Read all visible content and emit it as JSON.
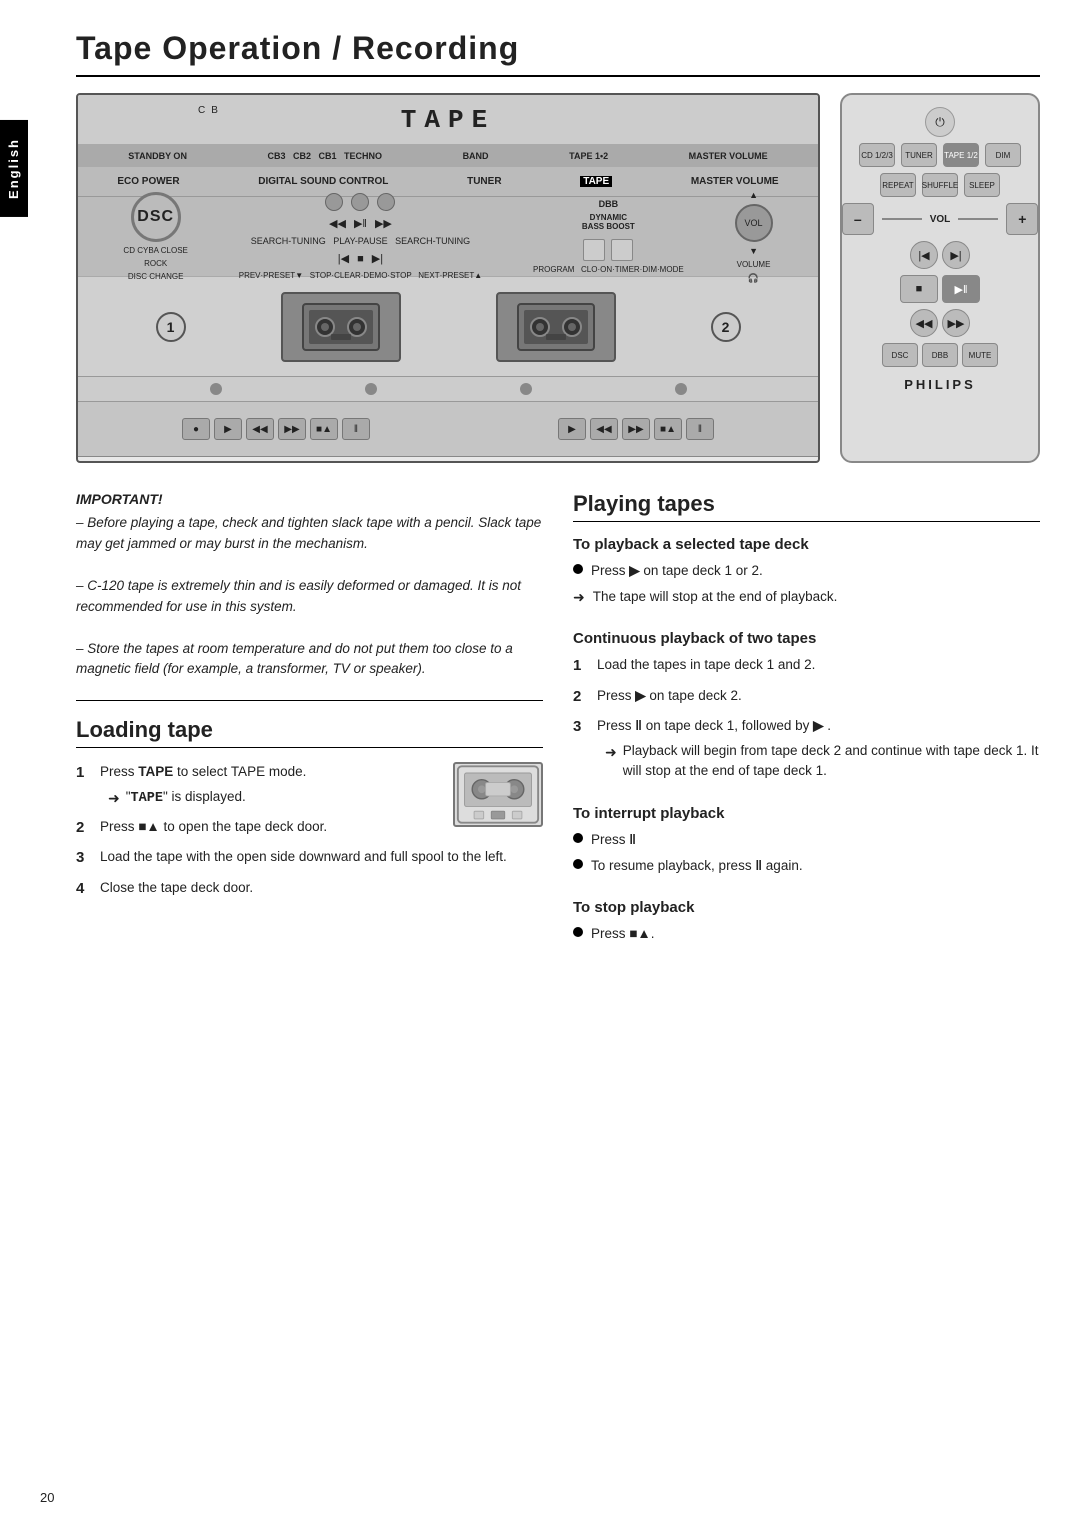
{
  "page": {
    "title": "Tape Operation / Recording",
    "page_number": "20",
    "language_tab": "English"
  },
  "device": {
    "display_text": "TAPE",
    "deck1_label": "1",
    "deck2_label": "2"
  },
  "remote": {
    "philips_label": "PHILIPS"
  },
  "important": {
    "title": "IMPORTANT!",
    "lines": [
      "– Before playing a tape, check and tighten slack tape with a pencil. Slack tape may get jammed or may burst in the mechanism.",
      "– C-120 tape is extremely thin and is easily deformed or damaged. It is not recommended for use in this system.",
      "– Store the tapes at room temperature and do not put them too close to a magnetic field (for example, a transformer, TV or speaker)."
    ]
  },
  "loading_tape": {
    "title": "Loading tape",
    "steps": [
      {
        "num": "1",
        "text": "Press TAPE to select TAPE mode.",
        "note": "\"TAPE\" is displayed."
      },
      {
        "num": "2",
        "text": "Press ■▲ to open the tape deck door."
      },
      {
        "num": "3",
        "text": "Load the tape with the open side downward and full spool to the left."
      },
      {
        "num": "4",
        "text": "Close the tape deck door."
      }
    ]
  },
  "playing_tapes": {
    "title": "Playing tapes",
    "selected_deck": {
      "title": "To playback a selected tape deck",
      "bullets": [
        "Press ▶ on tape deck 1 or 2.",
        "The tape will stop at the end of playback."
      ]
    },
    "continuous": {
      "title": "Continuous playback of two tapes",
      "steps": [
        {
          "num": "1",
          "text": "Load the tapes in tape deck 1 and 2."
        },
        {
          "num": "2",
          "text": "Press ▶ on tape deck 2."
        },
        {
          "num": "3",
          "text": "Press ‖ on tape deck 1, followed by ▶ .",
          "note": "Playback will begin from tape deck 2 and continue with tape deck 1. It will stop at the end of tape deck 1."
        }
      ]
    },
    "interrupt": {
      "title": "To interrupt playback",
      "bullets": [
        "Press ‖",
        "To resume playback, press ‖ again."
      ]
    },
    "stop": {
      "title": "To stop playback",
      "bullets": [
        "Press ■▲."
      ]
    }
  }
}
